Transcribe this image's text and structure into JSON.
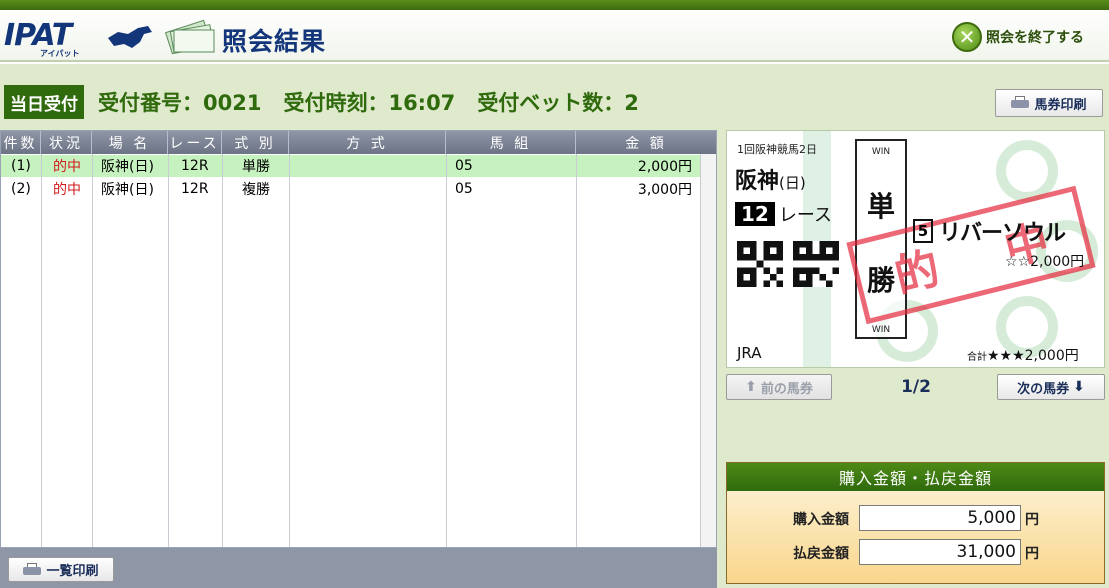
{
  "header": {
    "logo_text": "IPAT",
    "logo_sub": "アイパット",
    "title": "照会結果",
    "exit_label": "照会を終了する"
  },
  "status": {
    "tag": "当日受付",
    "receipt_no": "受付番号：0021",
    "receipt_time": "受付時刻：16:07",
    "bet_count": "受付ベット数：2"
  },
  "buttons": {
    "ticket_print": "馬券印刷",
    "list_print": "一覧印刷",
    "prev": "前の馬券",
    "next": "次の馬券"
  },
  "table": {
    "columns": [
      "件数",
      "状況",
      "場 名",
      "レース",
      "式 別",
      "方 式",
      "馬 組",
      "金 額"
    ],
    "rows": [
      {
        "no": "(1)",
        "status": "的中",
        "venue": "阪神(日)",
        "race": "12R",
        "type": "単勝",
        "method": "",
        "combo": "05",
        "amount": "2,000円"
      },
      {
        "no": "(2)",
        "status": "的中",
        "venue": "阪神(日)",
        "race": "12R",
        "type": "複勝",
        "method": "",
        "combo": "05",
        "amount": "3,000円"
      }
    ]
  },
  "ticket": {
    "meeting": "1回阪神競馬2日",
    "venue": "阪神",
    "day": "(日)",
    "race_num": "12",
    "race_label": "レース",
    "win_top": "WIN",
    "win_bottom": "WIN",
    "bet_type_1": "単",
    "bet_type_2": "勝",
    "horse_num": "5",
    "horse_name": "リバーソウル",
    "amount": "☆☆2,000円",
    "jra": "JRA",
    "total_label": "合計",
    "total_value": "★★★2,000円",
    "stamp_1": "的",
    "stamp_2": "中"
  },
  "pager": "1/2",
  "summary": {
    "title": "購入金額・払戻金額",
    "purchase_label": "購入金額",
    "purchase_value": "5,000",
    "payout_label": "払戻金額",
    "payout_value": "31,000",
    "unit": "円"
  },
  "colors": {
    "brand_green": "#2f6a0d",
    "navy": "#13357a",
    "hit_red": "#d11a1a",
    "selected_row": "#c6f2bf"
  }
}
